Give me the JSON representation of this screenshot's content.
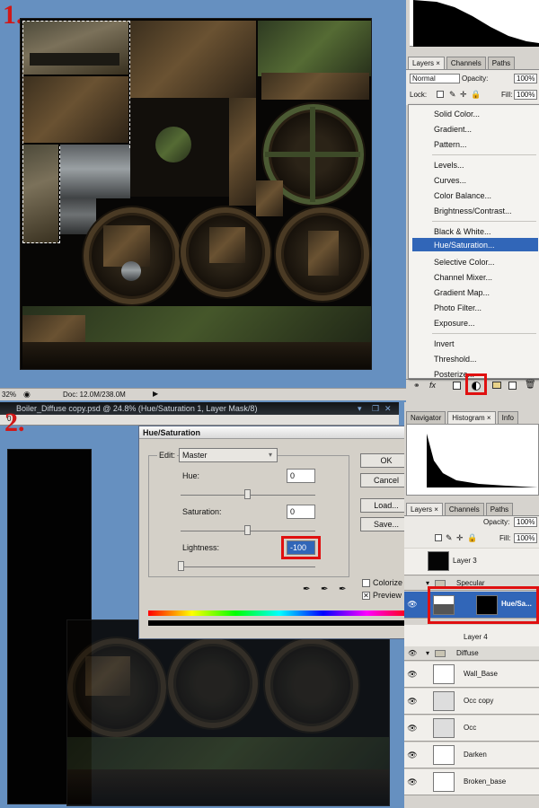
{
  "panel1": {
    "step_label": "1.",
    "layers_tabs": [
      "Layers ×",
      "Channels",
      "Paths"
    ],
    "blend_mode": "Normal",
    "opacity_label": "Opacity:",
    "opacity_value": "100%",
    "lock_label": "Lock:",
    "fill_label": "Fill:",
    "fill_value": "100%",
    "adjust_menu": [
      "Solid Color...",
      "Gradient...",
      "Pattern...",
      "Levels...",
      "Curves...",
      "Color Balance...",
      "Brightness/Contrast...",
      "Black & White...",
      "Hue/Saturation...",
      "Selective Color...",
      "Channel Mixer...",
      "Gradient Map...",
      "Photo Filter...",
      "Exposure...",
      "Invert",
      "Threshold...",
      "Posterize..."
    ],
    "highlighted_item": "Hue/Saturation...",
    "zoom": "32%",
    "doc_size": "Doc: 12.0M/238.0M"
  },
  "panel2": {
    "step_label": "2.",
    "window_title": "Boiler_Diffuse copy.psd @ 24.8% (Hue/Saturation 1, Layer Mask/8)",
    "ruler_zero": "0",
    "dock_tabs": [
      "Navigator",
      "Histogram ×",
      "Info"
    ],
    "layers_tabs": [
      "Layers ×",
      "Channels",
      "Paths"
    ],
    "opacity_label": "Opacity:",
    "opacity_value": "100%",
    "fill_label": "Fill:",
    "fill_value": "100%",
    "dialog": {
      "title": "Hue/Saturation",
      "edit_label": "Edit:",
      "edit_value": "Master",
      "hue_label": "Hue:",
      "hue_value": "0",
      "saturation_label": "Saturation:",
      "saturation_value": "0",
      "lightness_label": "Lightness:",
      "lightness_value": "-100",
      "ok": "OK",
      "cancel": "Cancel",
      "load": "Load...",
      "save": "Save...",
      "colorize": "Colorize",
      "preview": "Preview",
      "preview_checked": true
    },
    "layers": [
      {
        "name": "Layer 3",
        "type": "layer"
      },
      {
        "name": "Specular",
        "type": "group"
      },
      {
        "name": "Hue/Sa...",
        "type": "adjustment",
        "selected": true
      },
      {
        "name": "Layer 4",
        "type": "layer"
      },
      {
        "name": "Diffuse",
        "type": "group"
      },
      {
        "name": "Wall_Base",
        "type": "layer"
      },
      {
        "name": "Occ copy",
        "type": "layer"
      },
      {
        "name": "Occ",
        "type": "layer"
      },
      {
        "name": "Darken",
        "type": "layer"
      },
      {
        "name": "Broken_base",
        "type": "layer"
      }
    ]
  },
  "colors": {
    "highlight": "#3166b8",
    "callout_red": "#e01010",
    "canvas_bg": "#6690c0"
  }
}
